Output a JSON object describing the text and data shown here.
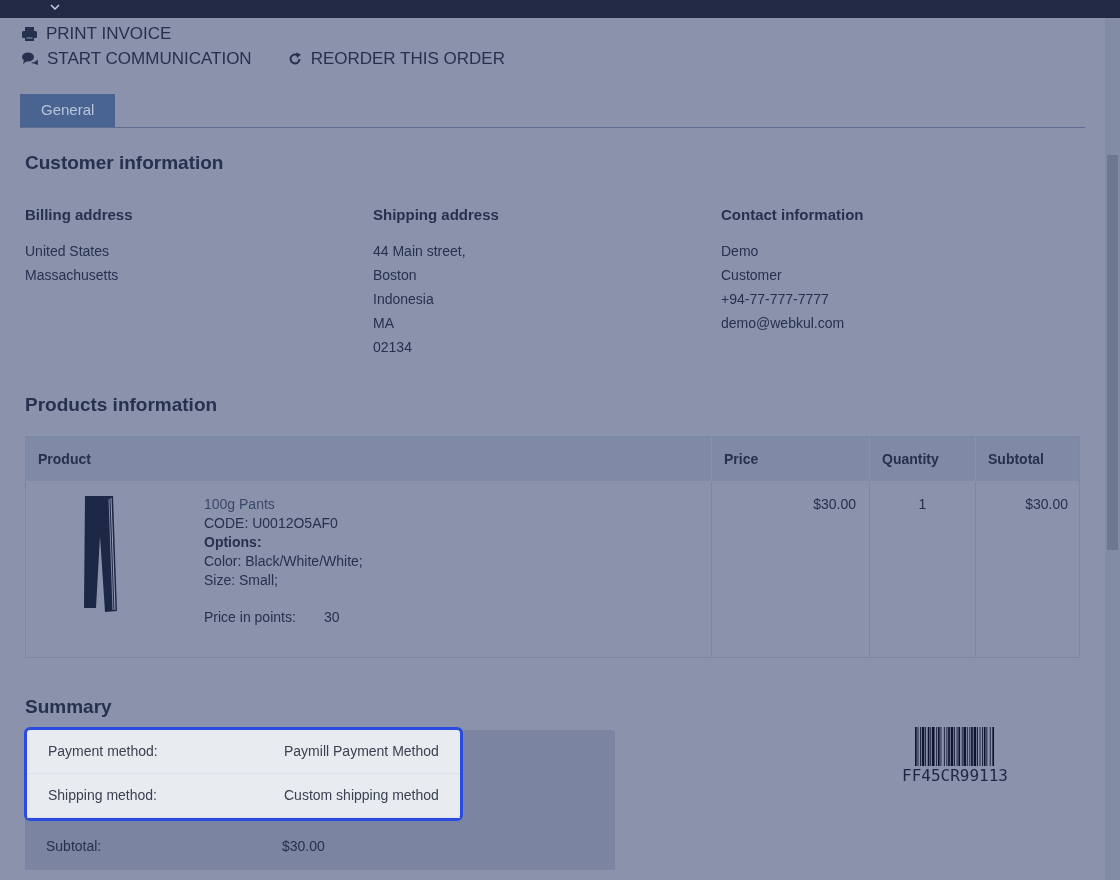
{
  "actions": [
    {
      "kind": "print",
      "label": "PRINT INVOICE"
    },
    {
      "kind": "chat",
      "label": "START COMMUNICATION"
    },
    {
      "kind": "reorder",
      "label": "REORDER THIS ORDER"
    }
  ],
  "tabs": [
    {
      "label": "General",
      "selected": true
    }
  ],
  "customer_information": {
    "title": "Customer information",
    "columns": [
      {
        "title": "Billing address",
        "lines": [
          "United States",
          "Massachusetts"
        ]
      },
      {
        "title": "Shipping address",
        "lines": [
          "44 Main street,",
          "Boston",
          "Indonesia",
          "MA",
          "02134"
        ]
      },
      {
        "title": "Contact information",
        "lines": [
          "Demo",
          "Customer",
          "+94-77-777-7777",
          "demo@webkul.com"
        ]
      }
    ]
  },
  "products_information": {
    "title": "Products information",
    "columns": [
      "Product",
      "Price",
      "Quantity",
      "Subtotal"
    ],
    "rows": [
      {
        "name": "100g Pants",
        "code": "CODE: U0012O5AF0",
        "options_label": "Options:",
        "options": [
          "Color: Black/White/White;",
          "Size: Small;"
        ],
        "points_label": "Price in points:",
        "points": "30",
        "price": "$30.00",
        "quantity": "1",
        "subtotal": "$30.00"
      }
    ]
  },
  "summary": {
    "title": "Summary",
    "rows": [
      {
        "label": "Payment method:",
        "value": "Paymill Payment Method",
        "highlighted": true
      },
      {
        "label": "Shipping method:",
        "value": "Custom shipping method",
        "highlighted": true
      },
      {
        "label": "Subtotal:",
        "value": "$30.00",
        "highlighted": false
      }
    ]
  },
  "barcode": {
    "text": "FF45CR99113"
  }
}
